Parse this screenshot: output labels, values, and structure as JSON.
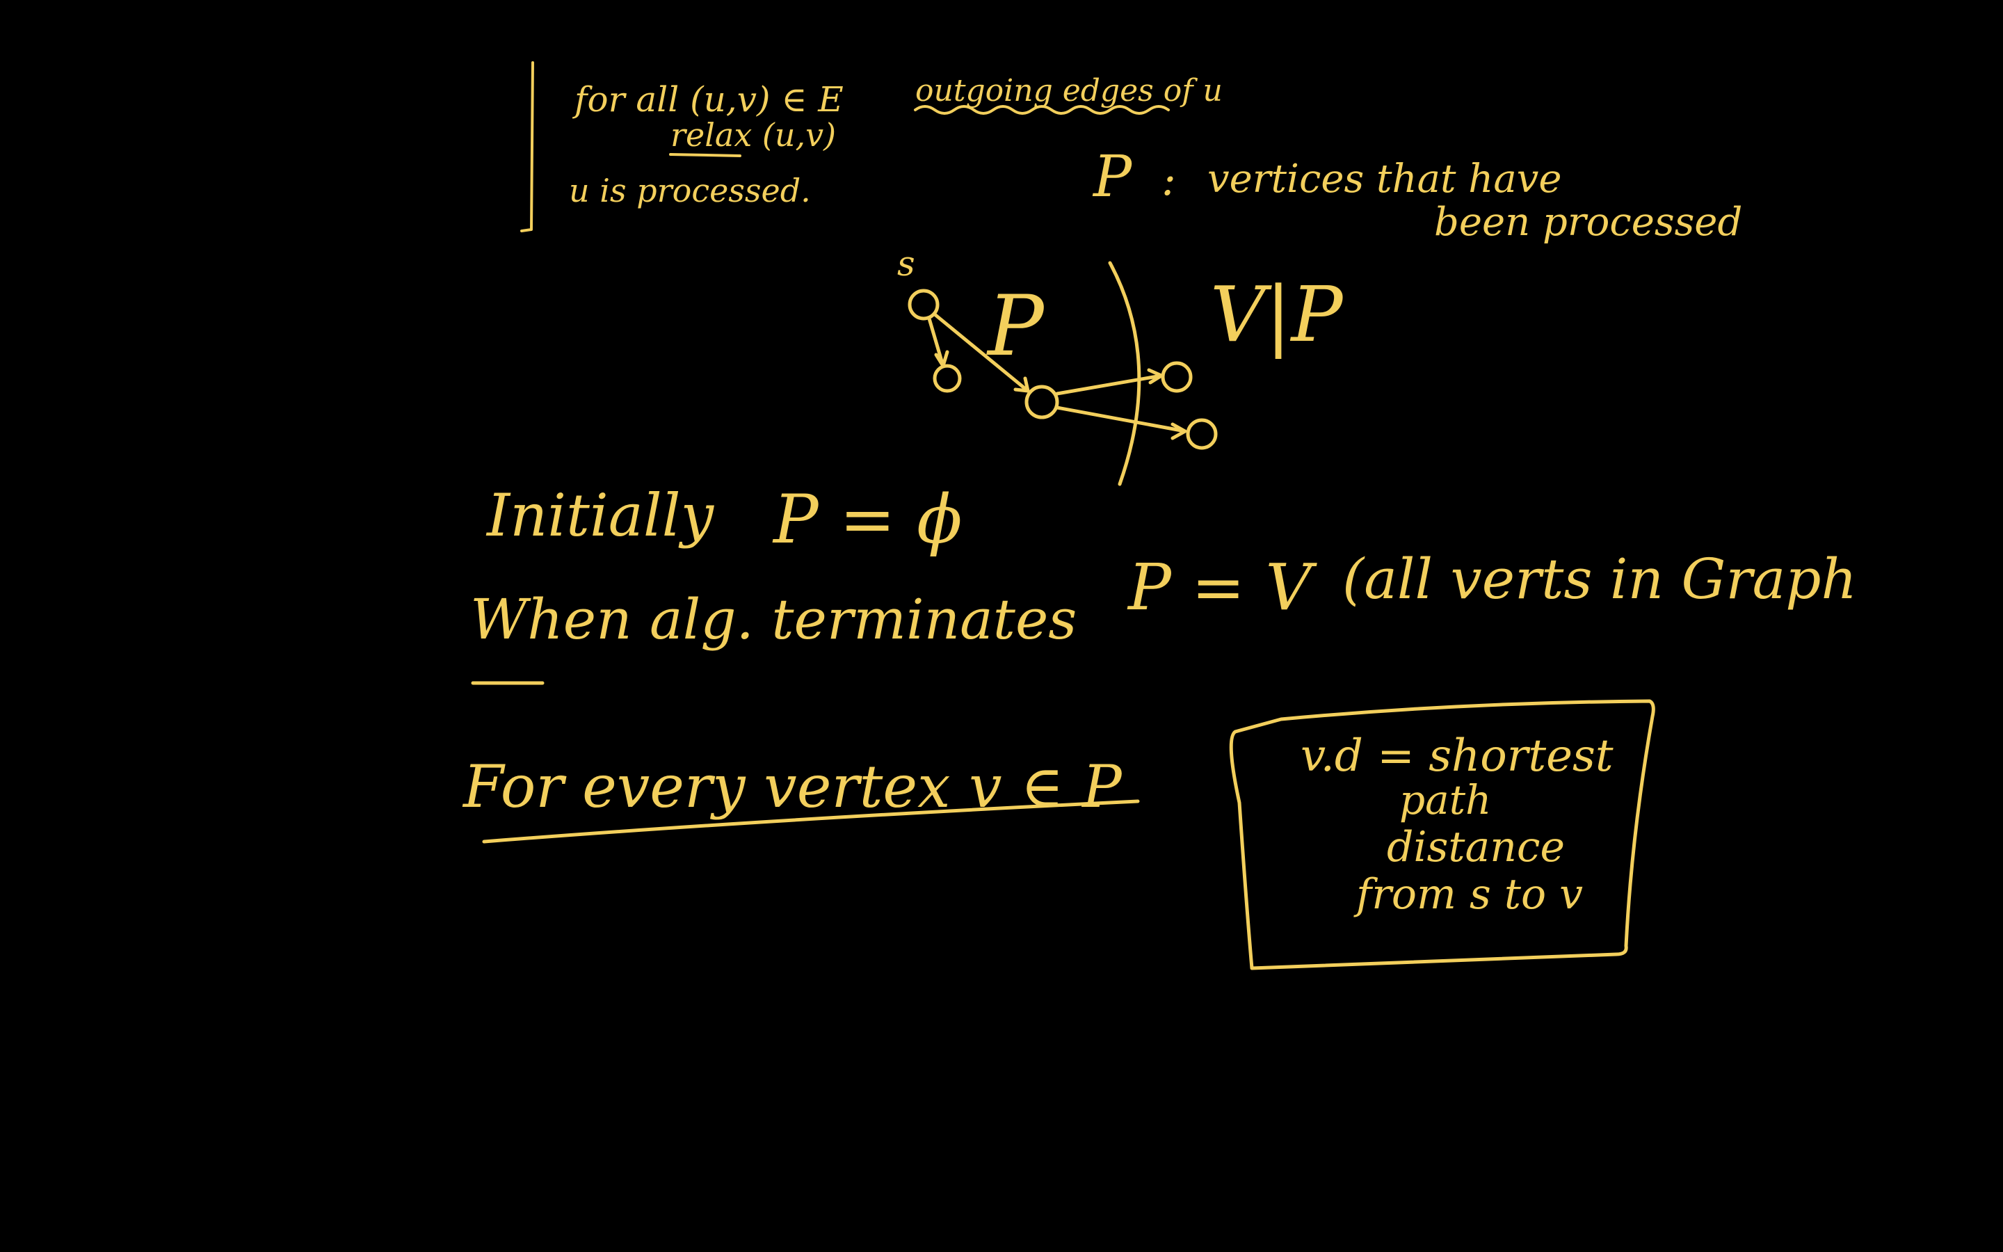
{
  "colors": {
    "background": "#000000",
    "ink": "#f3cf5c"
  },
  "pseudocode": {
    "line1": "for all (u,v) ∈ E",
    "line1_note": "outgoing edges of u",
    "line2": "relax (u,v)",
    "line3": "u is processed."
  },
  "definition": {
    "symbol": "P",
    "separator": ":",
    "text_line1": "vertices that have",
    "text_line2": "been processed"
  },
  "diagram": {
    "source_label": "s",
    "left_set_label": "P",
    "right_set_label": "V|P"
  },
  "statements": {
    "initially": "Initially",
    "initially_expr": "P = ϕ",
    "when_terminates": "When alg. terminates",
    "termination_expr": "P = V",
    "termination_note": "(all verts in Graph",
    "for_every_vertex": "For every vertex v ∈ P"
  },
  "boxed_note": {
    "line1": "v.d = shortest",
    "line2": "path",
    "line3": "distance",
    "line4": "from s to v"
  }
}
